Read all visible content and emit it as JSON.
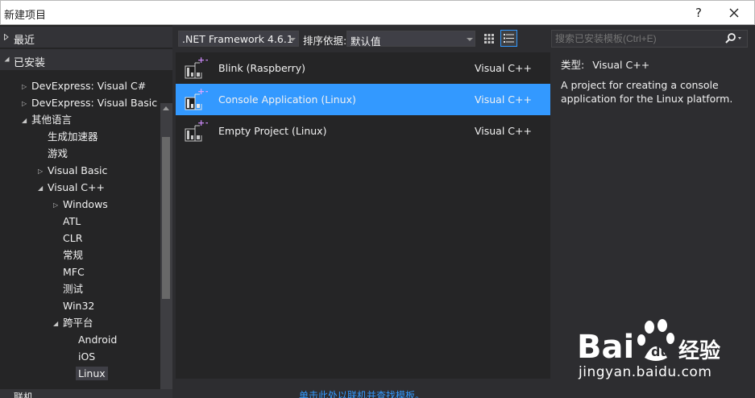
{
  "window": {
    "title": "新建项目",
    "help_label": "?",
    "close_icon": "close-icon"
  },
  "tree": {
    "recent_label": "最近",
    "installed_label": "已安装",
    "online_label": "联机",
    "nodes": [
      {
        "label": "DevExpress: Visual C#",
        "expander": "▷"
      },
      {
        "label": "DevExpress: Visual Basic",
        "expander": "▷"
      },
      {
        "label": "其他语言",
        "expander": "◢"
      },
      {
        "label": "生成加速器",
        "expander": ""
      },
      {
        "label": "游戏",
        "expander": ""
      },
      {
        "label": "Visual Basic",
        "expander": "▷"
      },
      {
        "label": "Visual C++",
        "expander": "◢"
      },
      {
        "label": "Windows",
        "expander": "▷"
      },
      {
        "label": "ATL",
        "expander": ""
      },
      {
        "label": "CLR",
        "expander": ""
      },
      {
        "label": "常规",
        "expander": ""
      },
      {
        "label": "MFC",
        "expander": ""
      },
      {
        "label": "测试",
        "expander": ""
      },
      {
        "label": "Win32",
        "expander": ""
      },
      {
        "label": "跨平台",
        "expander": "◢"
      },
      {
        "label": "Android",
        "expander": ""
      },
      {
        "label": "iOS",
        "expander": ""
      },
      {
        "label": "Linux",
        "expander": ""
      }
    ]
  },
  "toolbar": {
    "framework": ".NET Framework 4.6.1",
    "sort_label": "排序依据:",
    "sort_value": "默认值",
    "search_placeholder": "搜索已安装模板(Ctrl+E)"
  },
  "templates": [
    {
      "name": "Blink (Raspberry)",
      "language": "Visual C++",
      "selected": false
    },
    {
      "name": "Console Application (Linux)",
      "language": "Visual C++",
      "selected": true
    },
    {
      "name": "Empty Project (Linux)",
      "language": "Visual C++",
      "selected": false
    }
  ],
  "details": {
    "type_label": "类型:",
    "type_value": "Visual C++",
    "description": "A project for creating a console application for the Linux platform."
  },
  "online_link": "单击此处以联机并查找模板。",
  "watermark": {
    "logo_text": "Bai",
    "logo_suffix": "经验",
    "url": "jingyan.baidu.com"
  },
  "colors": {
    "accent": "#3399ff",
    "background": "#2d2d30",
    "panel": "#252526"
  }
}
